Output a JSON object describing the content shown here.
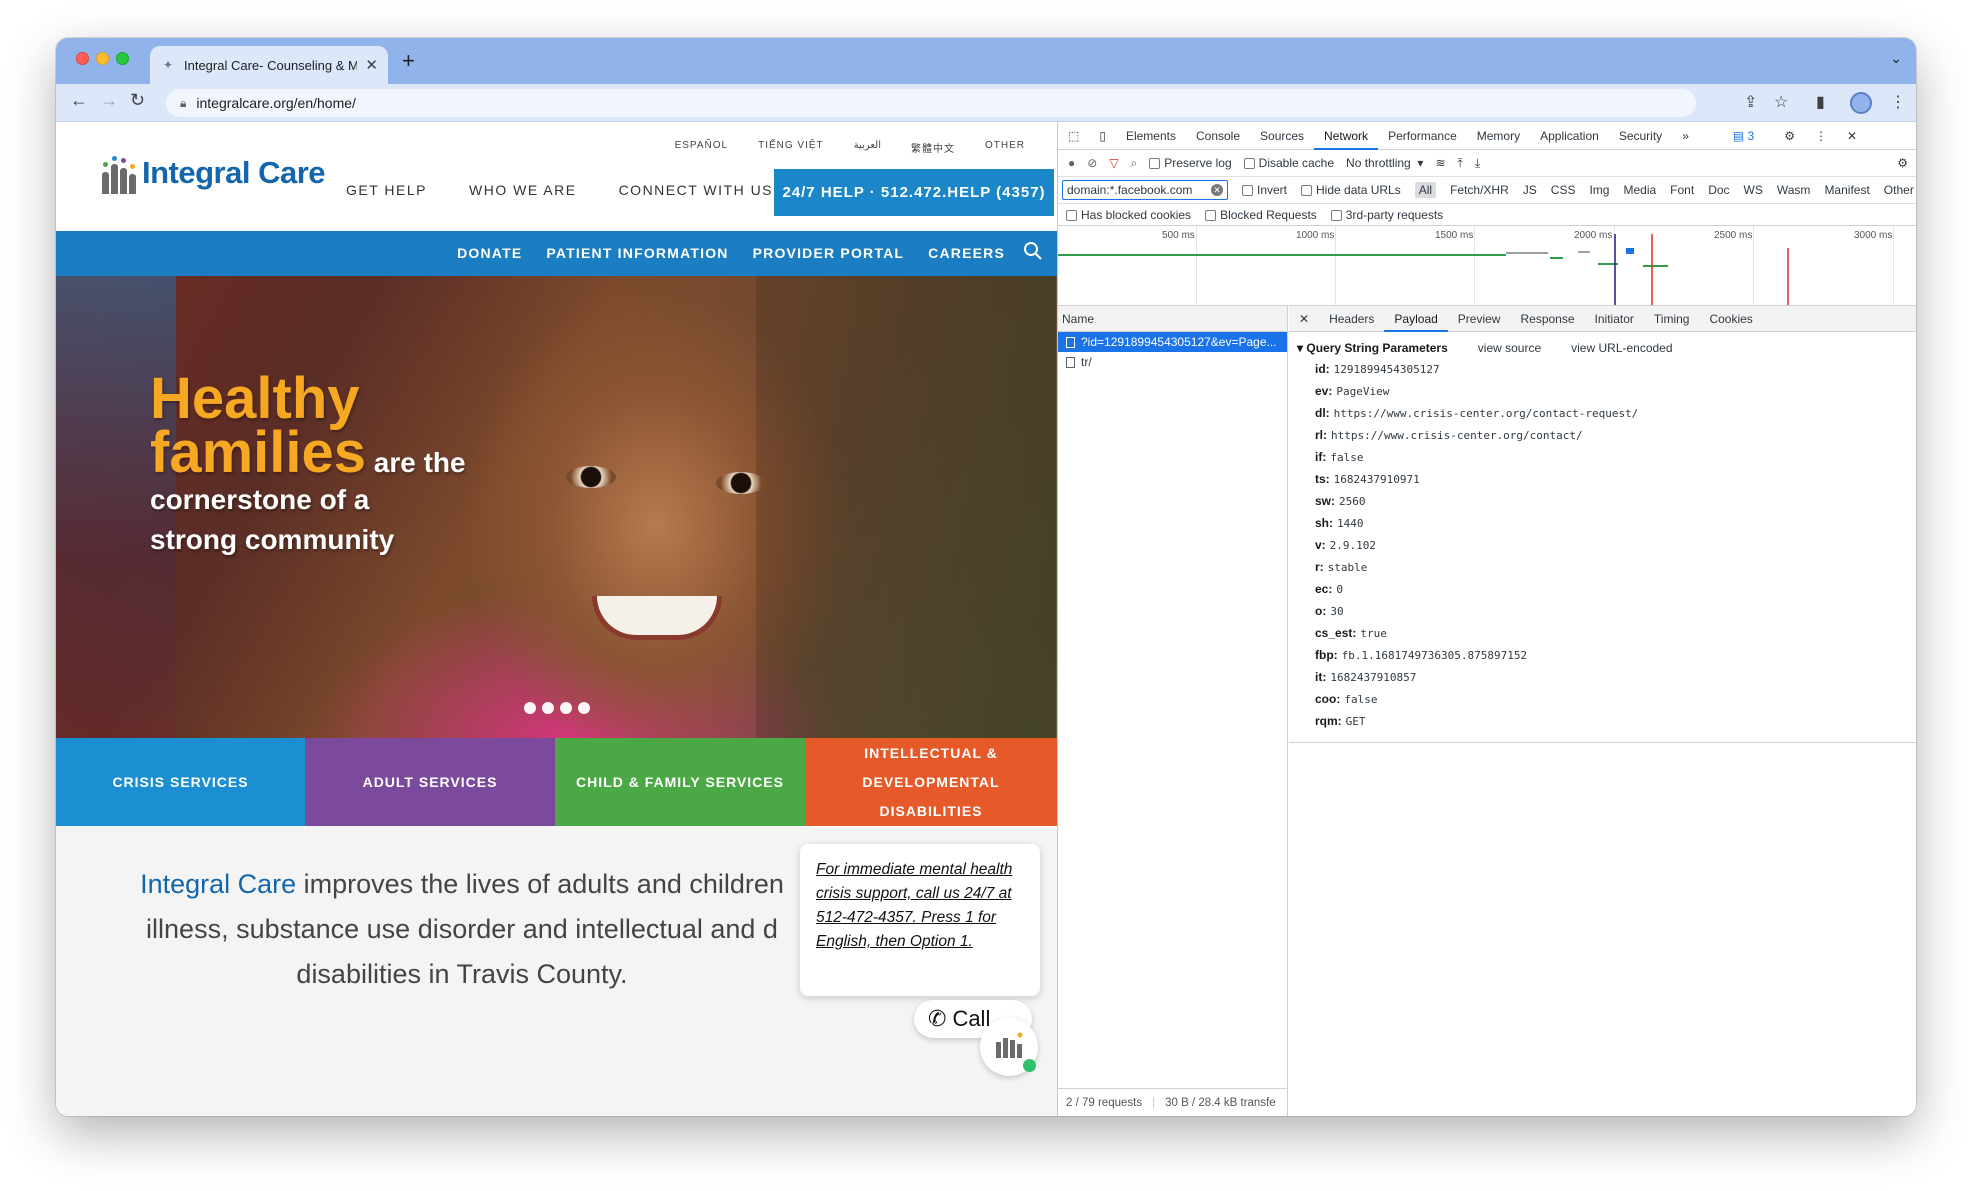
{
  "browser": {
    "tab_title": "Integral Care- Counseling & Me",
    "url": "integralcare.org/en/home/",
    "favicon": "integral-care-favicon"
  },
  "site": {
    "languages": [
      "ESPAÑOL",
      "TIẾNG VIỆT",
      "العربية",
      "繁體中文",
      "OTHER"
    ],
    "logo_text": "Integral Care",
    "main_nav": [
      "GET HELP",
      "WHO WE ARE",
      "CONNECT WITH US"
    ],
    "help_button": "24/7 HELP · 512.472.HELP (4357)",
    "secondary_nav": [
      "DONATE",
      "PATIENT INFORMATION",
      "PROVIDER PORTAL",
      "CAREERS"
    ],
    "hero": {
      "line1": "Healthy",
      "line2": "families",
      "line2b": " are the",
      "line3": "cornerstone of a",
      "line4": "strong community",
      "slide_count": 4
    },
    "services": [
      {
        "label": "CRISIS SERVICES",
        "color": "#1b8fd1"
      },
      {
        "label": "ADULT SERVICES",
        "color": "#7b4a9c"
      },
      {
        "label": "CHILD & FAMILY SERVICES",
        "color": "#4aa845"
      },
      {
        "label": "INTELLECTUAL & DEVELOPMENTAL DISABILITIES",
        "color": "#e65a29"
      }
    ],
    "intro_brand": "Integral Care",
    "intro_line1": " improves the lives of adults and children",
    "intro_line2": "illness, substance use disorder and intellectual and d",
    "intro_line3": "disabilities in Travis County.",
    "popup_text": "For immediate mental health crisis support, call us 24/7 at 512-472-4357. Press 1 for English, then Option 1.",
    "call_label": "Call"
  },
  "devtools": {
    "tabs": [
      "Elements",
      "Console",
      "Sources",
      "Network",
      "Performance",
      "Memory",
      "Application",
      "Security"
    ],
    "active_tab": "Network",
    "more_tabs": "»",
    "issues_count": "3",
    "preserve_log": "Preserve log",
    "disable_cache": "Disable cache",
    "throttling": "No throttling",
    "filter_value": "domain:*.facebook.com",
    "invert": "Invert",
    "hide_data_urls": "Hide data URLs",
    "type_filters": [
      "All",
      "Fetch/XHR",
      "JS",
      "CSS",
      "Img",
      "Media",
      "Font",
      "Doc",
      "WS",
      "Wasm",
      "Manifest",
      "Other"
    ],
    "blocked_cookies": "Has blocked cookies",
    "blocked_requests": "Blocked Requests",
    "third_party": "3rd-party requests",
    "timeline_ticks": [
      "500 ms",
      "1000 ms",
      "1500 ms",
      "2000 ms",
      "2500 ms",
      "3000 ms"
    ],
    "name_header": "Name",
    "requests": [
      "?id=1291899454305127&ev=Page...",
      "tr/"
    ],
    "status_requests": "2 / 79 requests",
    "status_transfer": "30 B / 28.4 kB transfe",
    "detail_tabs": [
      "Headers",
      "Payload",
      "Preview",
      "Response",
      "Initiator",
      "Timing",
      "Cookies"
    ],
    "active_detail_tab": "Payload",
    "qs_title": "Query String Parameters",
    "view_source": "view source",
    "view_url_encoded": "view URL-encoded",
    "params": [
      {
        "k": "id:",
        "v": "1291899454305127"
      },
      {
        "k": "ev:",
        "v": "PageView"
      },
      {
        "k": "dl:",
        "v": "https://www.crisis-center.org/contact-request/"
      },
      {
        "k": "rl:",
        "v": "https://www.crisis-center.org/contact/"
      },
      {
        "k": "if:",
        "v": "false"
      },
      {
        "k": "ts:",
        "v": "1682437910971"
      },
      {
        "k": "sw:",
        "v": "2560"
      },
      {
        "k": "sh:",
        "v": "1440"
      },
      {
        "k": "v:",
        "v": "2.9.102"
      },
      {
        "k": "r:",
        "v": "stable"
      },
      {
        "k": "ec:",
        "v": "0"
      },
      {
        "k": "o:",
        "v": "30"
      },
      {
        "k": "cs_est:",
        "v": "true"
      },
      {
        "k": "fbp:",
        "v": "fb.1.1681749736305.875897152"
      },
      {
        "k": "it:",
        "v": "1682437910857"
      },
      {
        "k": "coo:",
        "v": "false"
      },
      {
        "k": "rqm:",
        "v": "GET"
      }
    ]
  }
}
